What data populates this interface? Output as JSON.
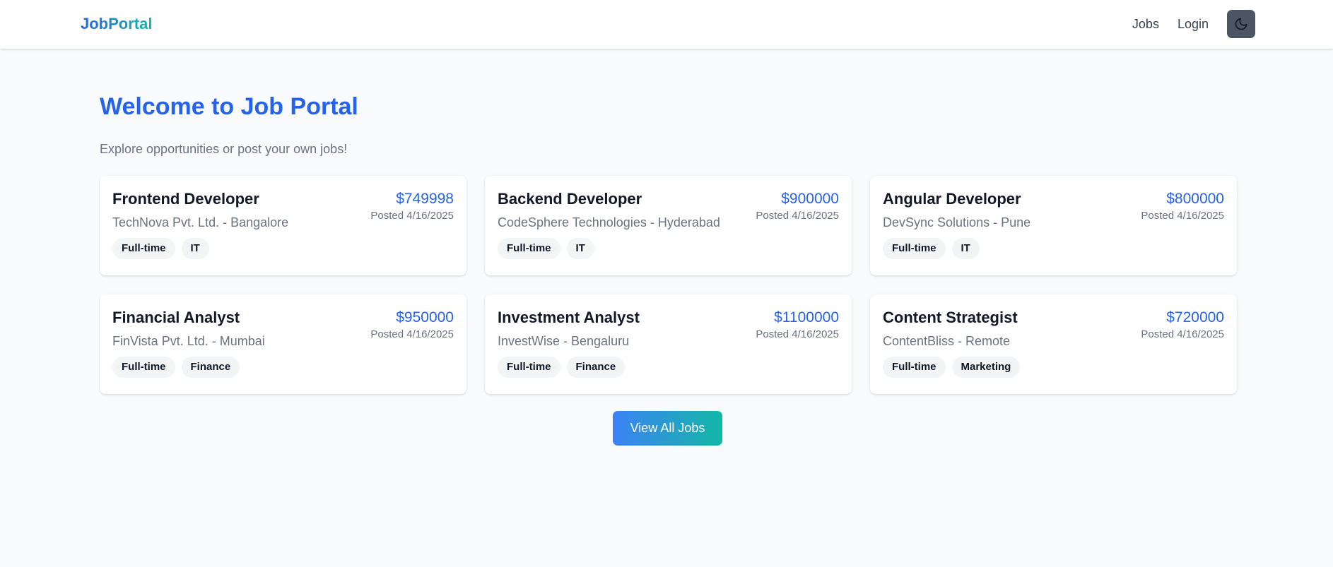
{
  "nav": {
    "logo": "JobPortal",
    "links": [
      "Jobs",
      "Login"
    ],
    "theme_toggle_icon": "moon-icon"
  },
  "hero": {
    "title": "Welcome to Job Portal",
    "subtitle": "Explore opportunities or post your own jobs!"
  },
  "jobs": [
    {
      "title": "Frontend Developer",
      "company": "TechNova Pvt. Ltd. - Bangalore",
      "salary": "$749998",
      "posted": "Posted 4/16/2025",
      "tags": [
        "Full-time",
        "IT"
      ]
    },
    {
      "title": "Backend Developer",
      "company": "CodeSphere Technologies - Hyderabad",
      "salary": "$900000",
      "posted": "Posted 4/16/2025",
      "tags": [
        "Full-time",
        "IT"
      ]
    },
    {
      "title": "Angular Developer",
      "company": "DevSync Solutions - Pune",
      "salary": "$800000",
      "posted": "Posted 4/16/2025",
      "tags": [
        "Full-time",
        "IT"
      ]
    },
    {
      "title": "Financial Analyst",
      "company": "FinVista Pvt. Ltd. - Mumbai",
      "salary": "$950000",
      "posted": "Posted 4/16/2025",
      "tags": [
        "Full-time",
        "Finance"
      ]
    },
    {
      "title": "Investment Analyst",
      "company": "InvestWise - Bengaluru",
      "salary": "$1100000",
      "posted": "Posted 4/16/2025",
      "tags": [
        "Full-time",
        "Finance"
      ]
    },
    {
      "title": "Content Strategist",
      "company": "ContentBliss - Remote",
      "salary": "$720000",
      "posted": "Posted 4/16/2025",
      "tags": [
        "Full-time",
        "Marketing"
      ]
    }
  ],
  "cta": {
    "label": "View All Jobs"
  },
  "colors": {
    "accent": "#2563eb",
    "teal": "#14b8a6",
    "toggle_bg": "#4b5563",
    "page_bg": "#f9fafb"
  }
}
